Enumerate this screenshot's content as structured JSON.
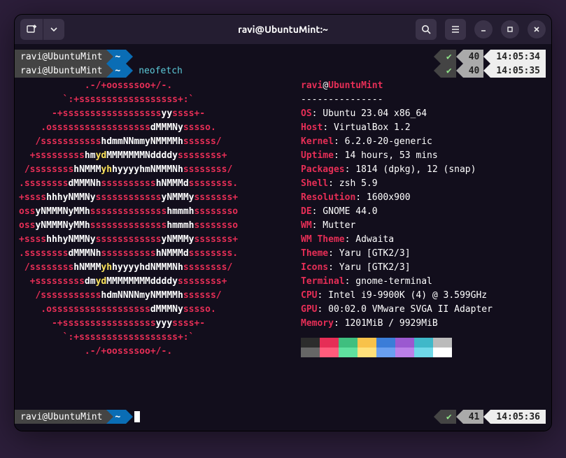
{
  "window": {
    "title": "ravi@UbuntuMint:~"
  },
  "prompts": [
    {
      "user": "ravi@UbuntuMint",
      "dir": "~",
      "cmd": "",
      "rcheck": "✔",
      "rnum": "40",
      "rtime": "14:05:34"
    },
    {
      "user": "ravi@UbuntuMint",
      "dir": "~",
      "cmd": "neofetch",
      "rcheck": "✔",
      "rnum": "40",
      "rtime": "14:05:35"
    }
  ],
  "prompt_bottom": {
    "user": "ravi@UbuntuMint",
    "dir": "~",
    "rcheck": "✔",
    "rnum": "41",
    "rtime": "14:05:36"
  },
  "info": {
    "userhost_user": "ravi",
    "userhost_at": "@",
    "userhost_host": "UbuntuMint",
    "dashes": "---------------",
    "rows": [
      {
        "k": "OS",
        "v": ": Ubuntu 23.04 x86_64"
      },
      {
        "k": "Host",
        "v": ": VirtualBox 1.2"
      },
      {
        "k": "Kernel",
        "v": ": 6.2.0-20-generic"
      },
      {
        "k": "Uptime",
        "v": ": 14 hours, 53 mins"
      },
      {
        "k": "Packages",
        "v": ": 1814 (dpkg), 12 (snap)"
      },
      {
        "k": "Shell",
        "v": ": zsh 5.9"
      },
      {
        "k": "Resolution",
        "v": ": 1600x900"
      },
      {
        "k": "DE",
        "v": ": GNOME 44.0"
      },
      {
        "k": "WM",
        "v": ": Mutter"
      },
      {
        "k": "WM Theme",
        "v": ": Adwaita"
      },
      {
        "k": "Theme",
        "v": ": Yaru [GTK2/3]"
      },
      {
        "k": "Icons",
        "v": ": Yaru [GTK2/3]"
      },
      {
        "k": "Terminal",
        "v": ": gnome-terminal"
      },
      {
        "k": "CPU",
        "v": ": Intel i9-9900K (4) @ 3.599GHz"
      },
      {
        "k": "GPU",
        "v": ": 00:02.0 VMware SVGA II Adapter"
      },
      {
        "k": "Memory",
        "v": ": 1201MiB / 9929MiB"
      }
    ]
  },
  "swatches_row1": [
    "#2c2c2c",
    "#e62e56",
    "#3fbf7f",
    "#f8c24a",
    "#3b7dd8",
    "#9b59d0",
    "#3fb8c9",
    "#bbbbbb"
  ],
  "swatches_row2": [
    "#666666",
    "#ff5c7c",
    "#5fe09f",
    "#ffe07a",
    "#6aa0f0",
    "#bb80e8",
    "#6fd8e8",
    "#ffffff"
  ],
  "ascii": [
    [
      [
        "r",
        "            .-/+oossssoo+/-.            "
      ]
    ],
    [
      [
        "r",
        "        `:+ssssssssssssssssss+:`        "
      ]
    ],
    [
      [
        "r",
        "      -+ssssssssssssssssss"
      ],
      [
        "w",
        "yy"
      ],
      [
        "r",
        "ssss+-"
      ]
    ],
    [
      [
        "r",
        "    .ossssssssssssssssss"
      ],
      [
        "w",
        "dMMMNy"
      ],
      [
        "r",
        "sssso."
      ]
    ],
    [
      [
        "r",
        "   /sssssssssss"
      ],
      [
        "w",
        "hdmmNNmmyNMMMMh"
      ],
      [
        "r",
        "ssssss/"
      ]
    ],
    [
      [
        "r",
        "  +sssssssss"
      ],
      [
        "w",
        "hm"
      ],
      [
        "y",
        "yd"
      ],
      [
        "w",
        "MMMMMMMNddddy"
      ],
      [
        "r",
        "ssssssss+"
      ]
    ],
    [
      [
        "r",
        " /ssssssss"
      ],
      [
        "w",
        "hNMMM"
      ],
      [
        "y",
        "yh"
      ],
      [
        "w",
        "hyyyyhmNMMMNh"
      ],
      [
        "r",
        "ssssssss/"
      ]
    ],
    [
      [
        "r",
        ".ssssssss"
      ],
      [
        "w",
        "dMMMNh"
      ],
      [
        "r",
        "ssssssssss"
      ],
      [
        "w",
        "hNMMMd"
      ],
      [
        "r",
        "ssssssss."
      ]
    ],
    [
      [
        "r",
        "+ssss"
      ],
      [
        "w",
        "hhhyNMMNy"
      ],
      [
        "r",
        "ssssssssssss"
      ],
      [
        "w",
        "yNMMMy"
      ],
      [
        "r",
        "sssssss+"
      ]
    ],
    [
      [
        "r",
        "oss"
      ],
      [
        "w",
        "yNMMMNyMMh"
      ],
      [
        "r",
        "ssssssssssssss"
      ],
      [
        "w",
        "hmmmh"
      ],
      [
        "r",
        "ssssssso"
      ]
    ],
    [
      [
        "r",
        "oss"
      ],
      [
        "w",
        "yNMMMNyMMh"
      ],
      [
        "r",
        "ssssssssssssss"
      ],
      [
        "w",
        "hmmmh"
      ],
      [
        "r",
        "ssssssso"
      ]
    ],
    [
      [
        "r",
        "+ssss"
      ],
      [
        "w",
        "hhhyNMMNy"
      ],
      [
        "r",
        "ssssssssssss"
      ],
      [
        "w",
        "yNMMMy"
      ],
      [
        "r",
        "sssssss+"
      ]
    ],
    [
      [
        "r",
        ".ssssssss"
      ],
      [
        "w",
        "dMMMNh"
      ],
      [
        "r",
        "ssssssssss"
      ],
      [
        "w",
        "hNMMMd"
      ],
      [
        "r",
        "ssssssss."
      ]
    ],
    [
      [
        "r",
        " /ssssssss"
      ],
      [
        "w",
        "hNMMM"
      ],
      [
        "y",
        "yh"
      ],
      [
        "w",
        "hyyyyhdNMMMNh"
      ],
      [
        "r",
        "ssssssss/"
      ]
    ],
    [
      [
        "r",
        "  +sssssssss"
      ],
      [
        "w",
        "dm"
      ],
      [
        "y",
        "yd"
      ],
      [
        "w",
        "MMMMMMMMddddy"
      ],
      [
        "r",
        "ssssssss+"
      ]
    ],
    [
      [
        "r",
        "   /sssssssssss"
      ],
      [
        "w",
        "hdmNNNNmyNMMMMh"
      ],
      [
        "r",
        "ssssss/"
      ]
    ],
    [
      [
        "r",
        "    .ossssssssssssssssss"
      ],
      [
        "w",
        "dMMMNy"
      ],
      [
        "r",
        "sssso."
      ]
    ],
    [
      [
        "r",
        "      -+sssssssssssssssss"
      ],
      [
        "w",
        "yyy"
      ],
      [
        "r",
        "ssss+-"
      ]
    ],
    [
      [
        "r",
        "        `:+ssssssssssssssssss+:`"
      ]
    ],
    [
      [
        "r",
        "            .-/+oossssoo+/-."
      ]
    ]
  ]
}
